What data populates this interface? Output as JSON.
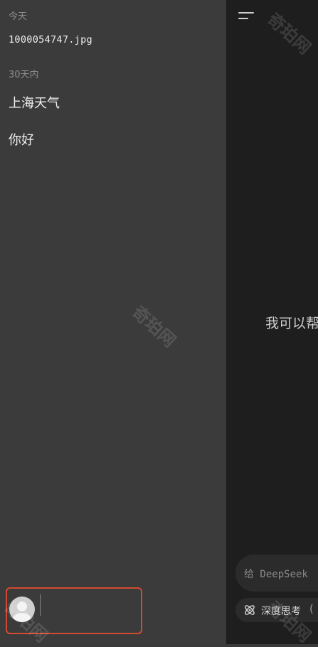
{
  "sidebar": {
    "sections": [
      {
        "label": "今天",
        "items": [
          {
            "label": "1000054747.jpg"
          }
        ]
      },
      {
        "label": "30天内",
        "items": [
          {
            "label": "上海天气"
          },
          {
            "label": "你好"
          }
        ]
      }
    ]
  },
  "main": {
    "welcome_text": "我可以帮",
    "input": {
      "placeholder": "给 DeepSeek"
    },
    "deep_think_chip": {
      "label": "深度思考"
    }
  },
  "watermark": {
    "text": "奇珀网"
  },
  "colors": {
    "highlight_border": "#d44a31",
    "sidebar_bg": "#3b3b3b",
    "main_bg": "#1e1e1e"
  }
}
